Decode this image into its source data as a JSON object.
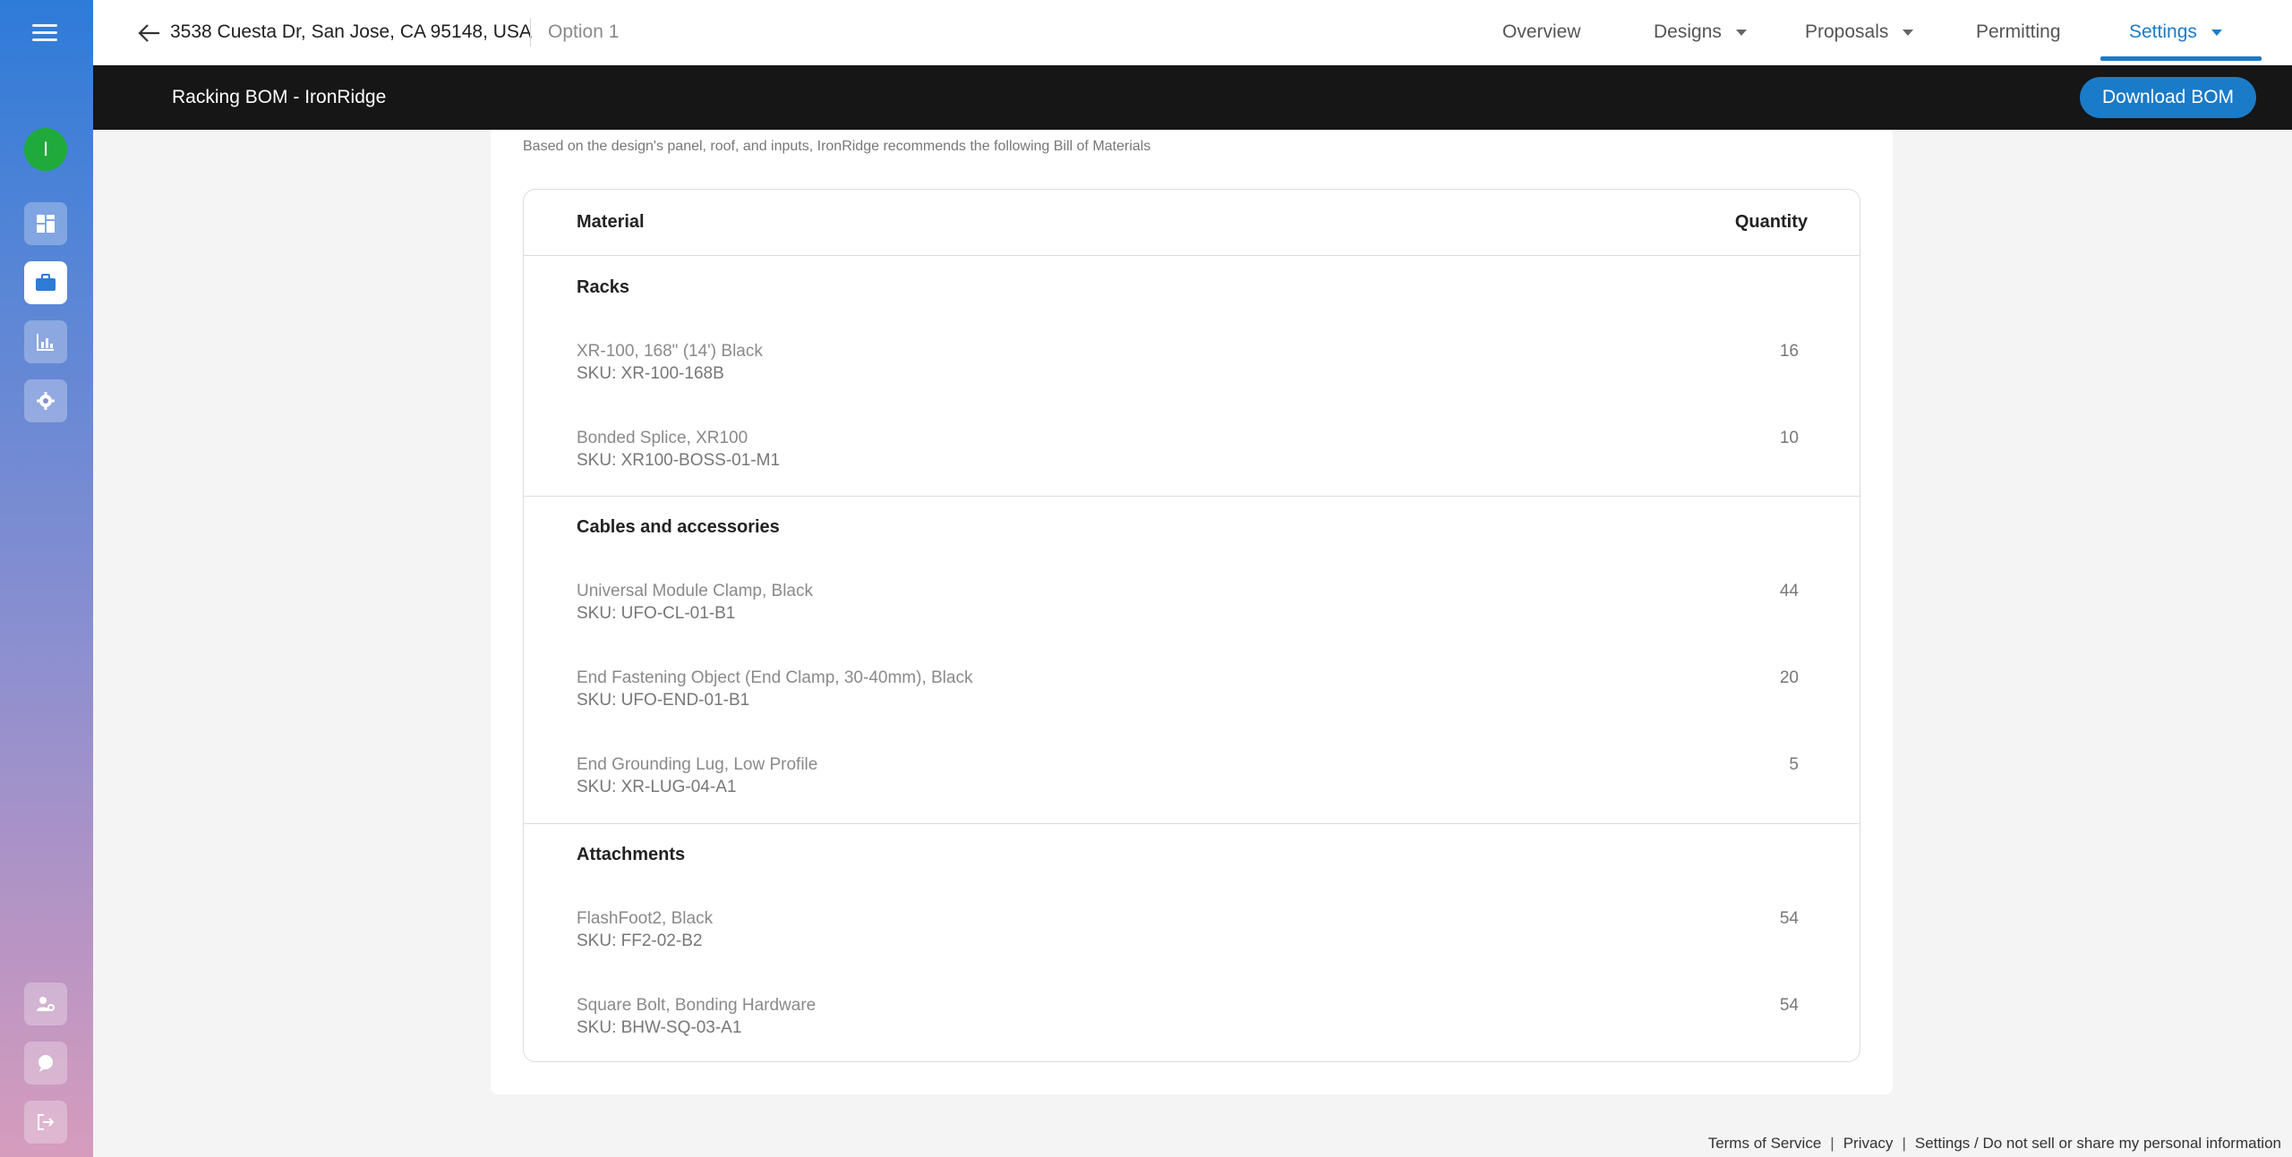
{
  "header": {
    "address": "3538 Cuesta Dr, San Jose, CA 95148, USA",
    "option": "Option 1"
  },
  "nav": {
    "overview": "Overview",
    "designs": "Designs",
    "proposals": "Proposals",
    "permitting": "Permitting",
    "settings": "Settings"
  },
  "sidebar": {
    "avatar_initial": "I",
    "icons": [
      "menu-icon",
      "dashboard-icon",
      "briefcase-icon",
      "chart-icon",
      "gear-icon",
      "user-settings-icon",
      "help-icon",
      "logout-icon"
    ]
  },
  "subheader": {
    "title": "Racking BOM - IronRidge",
    "download_label": "Download BOM"
  },
  "bom": {
    "intro": "Based on the design's panel, roof, and inputs, IronRidge recommends the following Bill of Materials",
    "col_material": "Material",
    "col_quantity": "Quantity",
    "sections": [
      {
        "title": "Racks",
        "items": [
          {
            "name": "XR-100, 168\" (14') Black",
            "sku": "SKU: XR-100-168B",
            "qty": "16"
          },
          {
            "name": "Bonded Splice, XR100",
            "sku": "SKU: XR100-BOSS-01-M1",
            "qty": "10"
          }
        ]
      },
      {
        "title": "Cables and accessories",
        "items": [
          {
            "name": "Universal Module Clamp, Black",
            "sku": "SKU: UFO-CL-01-B1",
            "qty": "44"
          },
          {
            "name": "End Fastening Object (End Clamp, 30-40mm), Black",
            "sku": "SKU: UFO-END-01-B1",
            "qty": "20"
          },
          {
            "name": "End Grounding Lug, Low Profile",
            "sku": "SKU: XR-LUG-04-A1",
            "qty": "5"
          }
        ]
      },
      {
        "title": "Attachments",
        "items": [
          {
            "name": "FlashFoot2, Black",
            "sku": "SKU: FF2-02-B2",
            "qty": "54"
          },
          {
            "name": "Square Bolt, Bonding Hardware",
            "sku": "SKU: BHW-SQ-03-A1",
            "qty": "54"
          }
        ]
      }
    ]
  },
  "footer": {
    "terms": "Terms of Service",
    "privacy": "Privacy",
    "settings": "Settings / Do not sell or share my personal information"
  },
  "colors": {
    "accent": "#1a7bc9",
    "dark_header": "#161616",
    "avatar": "#1faa3b"
  }
}
